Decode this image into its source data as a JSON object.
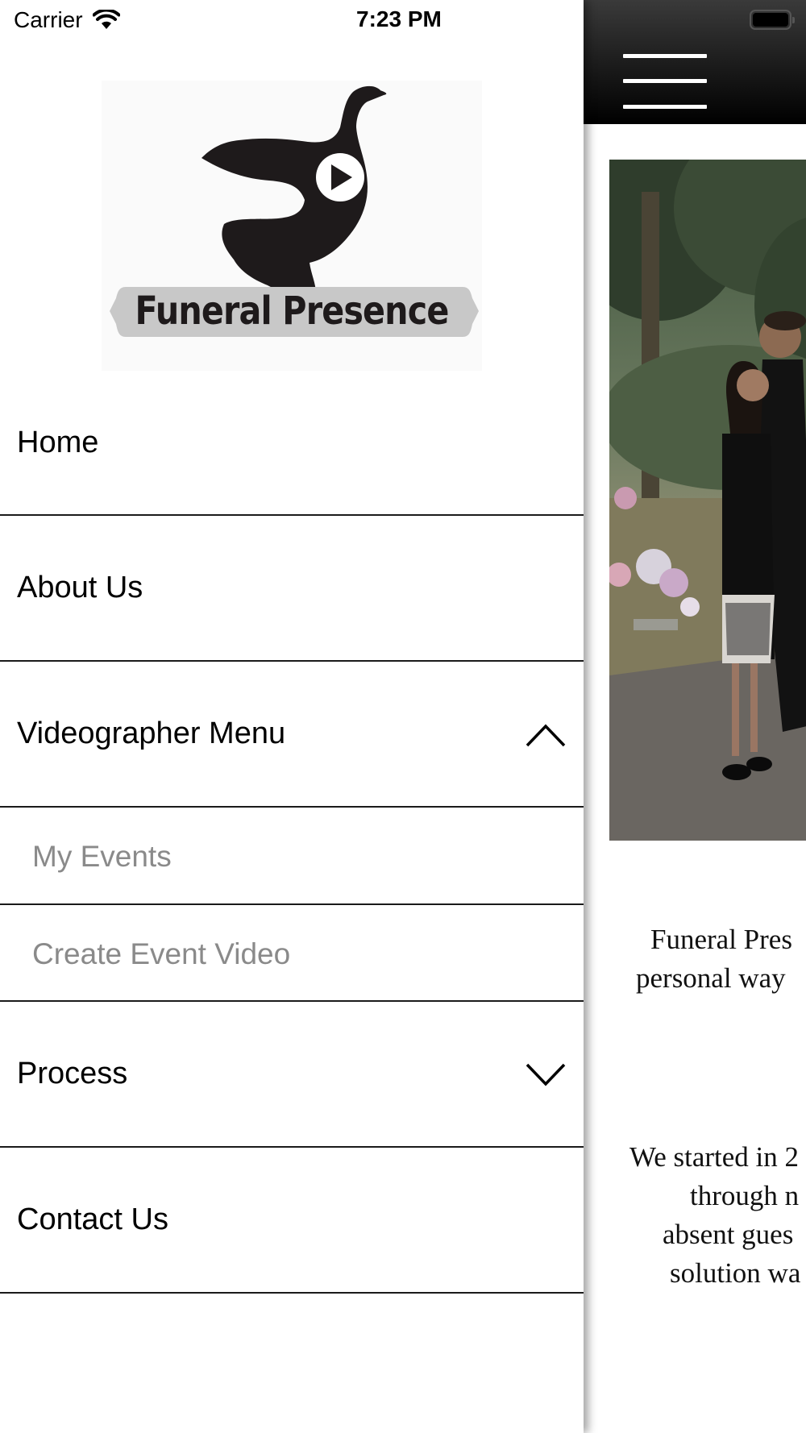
{
  "status_bar": {
    "carrier": "Carrier",
    "time": "7:23 PM"
  },
  "brand": {
    "name": "Funeral Presence",
    "logo_color": "#1e1a1b",
    "banner_color": "#c8c8c8"
  },
  "menu": {
    "items": [
      {
        "label": "Home"
      },
      {
        "label": "About Us"
      },
      {
        "label": "Videographer Menu",
        "expanded": true,
        "icon": "chevron-up-icon"
      },
      {
        "label": "My Events",
        "submenu": true
      },
      {
        "label": "Create Event Video",
        "submenu": true
      },
      {
        "label": "Process",
        "expanded": false,
        "icon": "chevron-down-icon"
      },
      {
        "label": "Contact Us"
      }
    ]
  },
  "main": {
    "header_color": "#1a1a1a",
    "menu_icon": "hamburger-icon",
    "intro_lines": [
      "Funeral Pres",
      "personal way"
    ],
    "story_lines": [
      "We started in 2",
      "through n",
      "absent gues",
      "solution wa"
    ]
  }
}
